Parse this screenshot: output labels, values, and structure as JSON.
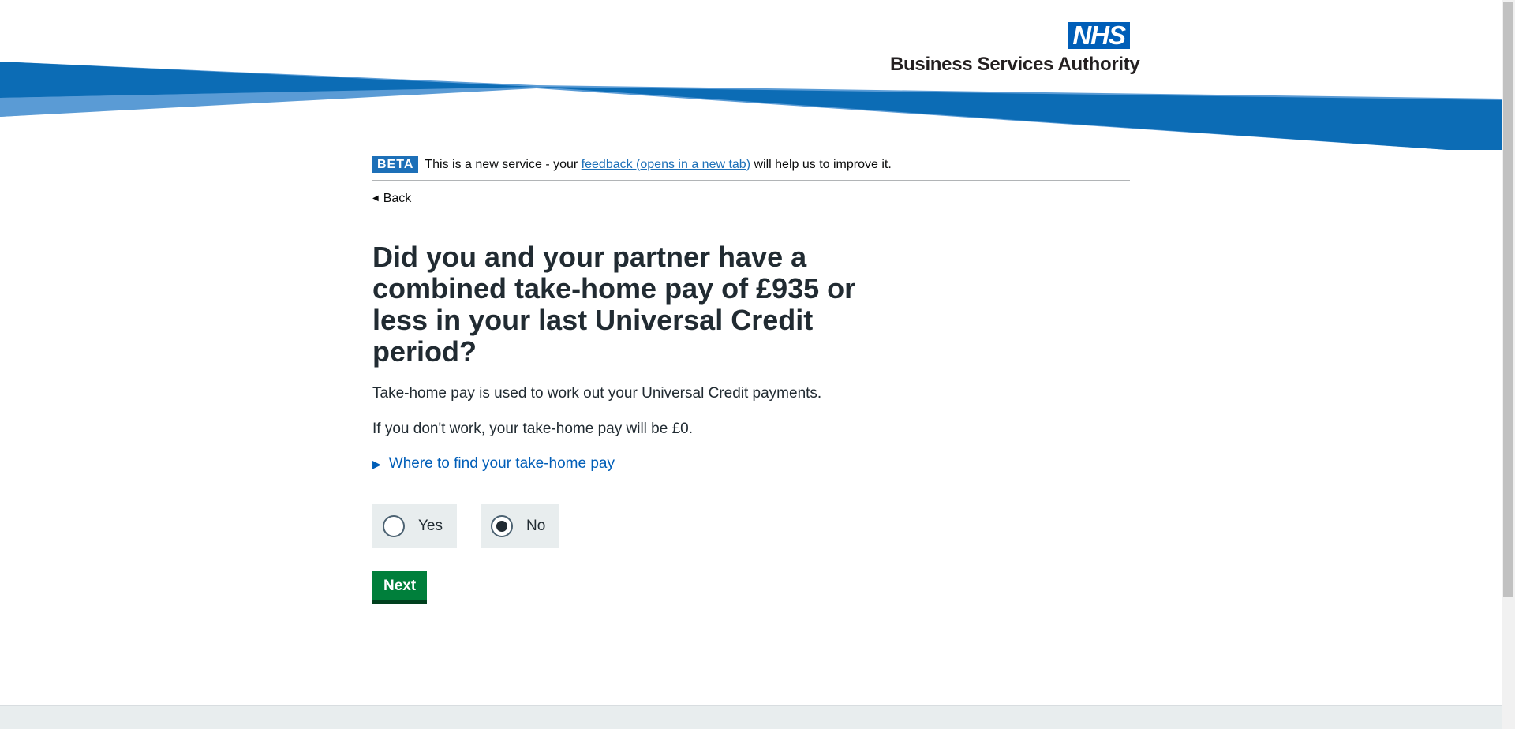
{
  "header": {
    "logo_nhs": "NHS",
    "logo_text": "Business Services Authority",
    "colors": {
      "band_dark": "#0f6cb6",
      "band_light": "#5599d6"
    }
  },
  "phase_banner": {
    "tag": "BETA",
    "text_before": "This is a new service - your",
    "link": "feedback (opens in a new tab)",
    "text_after": "will help us to improve it."
  },
  "back_link": "Back",
  "question": {
    "title": "Did you and your partner have a combined take-home pay of £935 or less in your last Universal Credit period?",
    "hint1": "Take-home pay is used to work out your Universal Credit payments.",
    "hint2": "If you don't work, your take-home pay will be £0.",
    "details_summary": "Where to find your take-home pay"
  },
  "options": [
    {
      "label": "Yes",
      "selected": false
    },
    {
      "label": "No",
      "selected": true
    }
  ],
  "next_button": "Next"
}
